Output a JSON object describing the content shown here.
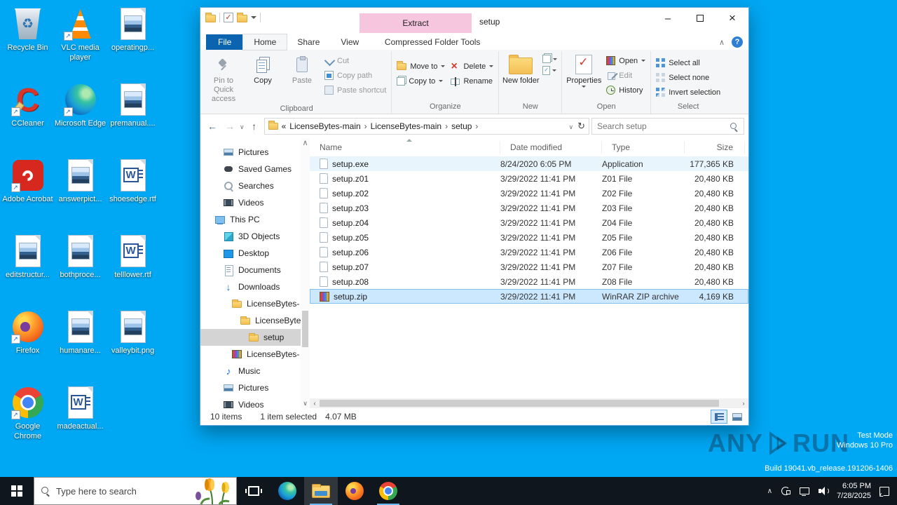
{
  "colors": {
    "desktop_bg": "#00a7f3",
    "file_tab_blue": "#0c63b0",
    "contextual_pink": "#f6c6de",
    "selection_blue": "#cce8ff",
    "taskbar_bg": "#10161d"
  },
  "desktop": {
    "icons": [
      {
        "label": "Recycle Bin",
        "icon": "recycle-bin",
        "shortcut": false
      },
      {
        "label": "VLC media player",
        "icon": "vlc",
        "shortcut": true
      },
      {
        "label": "operatingp...",
        "icon": "image",
        "shortcut": false
      },
      {
        "label": "CCleaner",
        "icon": "ccleaner",
        "shortcut": true
      },
      {
        "label": "Microsoft Edge",
        "icon": "edge",
        "shortcut": true
      },
      {
        "label": "premanual....",
        "icon": "image",
        "shortcut": false
      },
      {
        "label": "Adobe Acrobat",
        "icon": "adobe",
        "shortcut": true
      },
      {
        "label": "answerpict...",
        "icon": "image",
        "shortcut": false
      },
      {
        "label": "shoesedge.rtf",
        "icon": "word",
        "shortcut": false
      },
      {
        "label": "editstructur...",
        "icon": "image",
        "shortcut": false
      },
      {
        "label": "bothproce...",
        "icon": "image",
        "shortcut": false
      },
      {
        "label": "telllower.rtf",
        "icon": "word",
        "shortcut": false
      },
      {
        "label": "Firefox",
        "icon": "firefox",
        "shortcut": true
      },
      {
        "label": "humanare...",
        "icon": "image",
        "shortcut": false
      },
      {
        "label": "valleybit.png",
        "icon": "image",
        "shortcut": false
      },
      {
        "label": "Google Chrome",
        "icon": "chrome",
        "shortcut": true
      },
      {
        "label": "madeactual...",
        "icon": "word",
        "shortcut": false
      }
    ]
  },
  "window": {
    "title": "setup",
    "contextual_header": "Extract"
  },
  "tabs": {
    "file": "File",
    "home": "Home",
    "share": "Share",
    "view": "View",
    "contextual": "Compressed Folder Tools"
  },
  "ribbon": {
    "pin": "Pin to Quick access",
    "copy": "Copy",
    "paste": "Paste",
    "cut": "Cut",
    "copy_path": "Copy path",
    "paste_shortcut": "Paste shortcut",
    "clipboard_group": "Clipboard",
    "move_to": "Move to",
    "copy_to": "Copy to",
    "delete": "Delete",
    "rename": "Rename",
    "organize_group": "Organize",
    "new_folder": "New folder",
    "new_group": "New",
    "properties": "Properties",
    "open": "Open",
    "edit": "Edit",
    "history": "History",
    "open_group": "Open",
    "select_all": "Select all",
    "select_none": "Select none",
    "invert_selection": "Invert selection",
    "select_group": "Select"
  },
  "address": {
    "breadcrumb_prefix": "«",
    "segments": [
      "LicenseBytes-main",
      "LicenseBytes-main",
      "setup"
    ],
    "search_placeholder": "Search setup"
  },
  "nav": {
    "items": [
      {
        "label": "Pictures",
        "icon": "pictures",
        "indent": 2,
        "selected": false
      },
      {
        "label": "Saved Games",
        "icon": "saved-games",
        "indent": 2,
        "selected": false
      },
      {
        "label": "Searches",
        "icon": "search",
        "indent": 2,
        "selected": false
      },
      {
        "label": "Videos",
        "icon": "videos",
        "indent": 2,
        "selected": false
      },
      {
        "label": "This PC",
        "icon": "pc",
        "indent": 1,
        "selected": false
      },
      {
        "label": "3D Objects",
        "icon": "objects3d",
        "indent": 2,
        "selected": false
      },
      {
        "label": "Desktop",
        "icon": "desktop",
        "indent": 2,
        "selected": false
      },
      {
        "label": "Documents",
        "icon": "documents",
        "indent": 2,
        "selected": false
      },
      {
        "label": "Downloads",
        "icon": "downloads",
        "indent": 2,
        "selected": false
      },
      {
        "label": "LicenseBytes-",
        "icon": "folder",
        "indent": 3,
        "selected": false
      },
      {
        "label": "LicenseByte",
        "icon": "folder",
        "indent": 4,
        "selected": false
      },
      {
        "label": "setup",
        "icon": "folder",
        "indent": 5,
        "selected": true
      },
      {
        "label": "LicenseBytes-",
        "icon": "winrar",
        "indent": 3,
        "selected": false
      },
      {
        "label": "Music",
        "icon": "music",
        "indent": 2,
        "selected": false
      },
      {
        "label": "Pictures",
        "icon": "pictures",
        "indent": 2,
        "selected": false
      },
      {
        "label": "Videos",
        "icon": "videos",
        "indent": 2,
        "selected": false
      }
    ]
  },
  "files": {
    "columns": [
      "Name",
      "Date modified",
      "Type",
      "Size"
    ],
    "rows": [
      {
        "name": "setup.exe",
        "date": "8/24/2020 6:05 PM",
        "type": "Application",
        "size": "177,365 KB",
        "icon": "file",
        "state": "hover"
      },
      {
        "name": "setup.z01",
        "date": "3/29/2022 11:41 PM",
        "type": "Z01 File",
        "size": "20,480 KB",
        "icon": "file",
        "state": ""
      },
      {
        "name": "setup.z02",
        "date": "3/29/2022 11:41 PM",
        "type": "Z02 File",
        "size": "20,480 KB",
        "icon": "file",
        "state": ""
      },
      {
        "name": "setup.z03",
        "date": "3/29/2022 11:41 PM",
        "type": "Z03 File",
        "size": "20,480 KB",
        "icon": "file",
        "state": ""
      },
      {
        "name": "setup.z04",
        "date": "3/29/2022 11:41 PM",
        "type": "Z04 File",
        "size": "20,480 KB",
        "icon": "file",
        "state": ""
      },
      {
        "name": "setup.z05",
        "date": "3/29/2022 11:41 PM",
        "type": "Z05 File",
        "size": "20,480 KB",
        "icon": "file",
        "state": ""
      },
      {
        "name": "setup.z06",
        "date": "3/29/2022 11:41 PM",
        "type": "Z06 File",
        "size": "20,480 KB",
        "icon": "file",
        "state": ""
      },
      {
        "name": "setup.z07",
        "date": "3/29/2022 11:41 PM",
        "type": "Z07 File",
        "size": "20,480 KB",
        "icon": "file",
        "state": ""
      },
      {
        "name": "setup.z08",
        "date": "3/29/2022 11:41 PM",
        "type": "Z08 File",
        "size": "20,480 KB",
        "icon": "file",
        "state": ""
      },
      {
        "name": "setup.zip",
        "date": "3/29/2022 11:41 PM",
        "type": "WinRAR ZIP archive",
        "size": "4,169 KB",
        "icon": "winrar",
        "state": "selected"
      }
    ]
  },
  "status": {
    "items": "10 items",
    "selected": "1 item selected",
    "size": "4.07 MB"
  },
  "taskbar": {
    "search_placeholder": "Type here to search"
  },
  "tray": {
    "time": "6:05 PM",
    "date": "7/28/2025"
  },
  "watermark": {
    "brand_left": "ANY",
    "brand_right": "RUN",
    "line1": "Test Mode",
    "line2": "Windows 10 Pro",
    "line3": "Build 19041.vb_release.191206-1406"
  }
}
